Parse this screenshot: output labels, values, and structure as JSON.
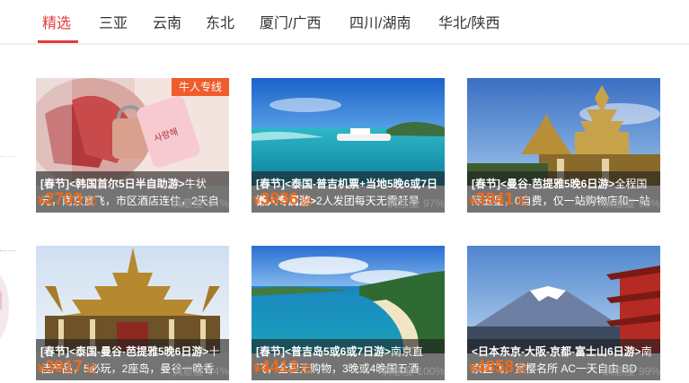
{
  "tabs": [
    {
      "label": "精选",
      "active": true
    },
    {
      "label": "三亚"
    },
    {
      "label": "云南"
    },
    {
      "label": "东北"
    },
    {
      "label": "厦门/广西"
    },
    {
      "label": "四川/湖南"
    },
    {
      "label": "华北/陕西"
    }
  ],
  "products": [
    {
      "badge": "牛人专线",
      "title": "[春节]<韩国首尔5日半自助游>",
      "desc": "牛状元，南京直飞，市区酒店连住，2天自",
      "currency": "¥",
      "price": "2703",
      "price_suffix": "起",
      "satisfaction_label": "满意度",
      "satisfaction": "94%",
      "image_icon": "love-locks-photo"
    },
    {
      "title": "[春节]<泰国-普吉机票+当地5晚6或7日懒人专属游>",
      "desc": "2人发团每天无需赶早",
      "currency": "¥",
      "price": "3836",
      "price_suffix": "起",
      "satisfaction_label": "满意度",
      "satisfaction": "97%",
      "image_icon": "tropical-sea-boat-photo"
    },
    {
      "title": "[春节]<曼谷-芭提雅5晚6日游>",
      "desc": "全程国际五星，0自费，仅一站购物店和一站",
      "currency": "¥",
      "price": "3941",
      "price_suffix": "起",
      "satisfaction_label": "满意度",
      "satisfaction": "98%",
      "image_icon": "thai-temple-photo"
    },
    {
      "title": "[春节]<泰国-曼谷-芭提雅5晚6日游>",
      "desc": "十佳产品，5必玩，2座岛，曼谷一晚香",
      "currency": "¥",
      "price": "3917",
      "price_suffix": "起",
      "satisfaction_label": "满意度",
      "satisfaction": "94%",
      "image_icon": "golden-palace-photo"
    },
    {
      "title": "[春节]<普吉岛5或6或7日游>",
      "desc": "南京直飞，全程无购物，3晚或4晚国五酒",
      "currency": "¥",
      "price": "4413",
      "price_suffix": "起",
      "satisfaction_label": "满意度",
      "satisfaction": "100%",
      "image_icon": "bay-beach-photo"
    },
    {
      "title": "<日本东京-大阪-京都-富士山6日游>",
      "desc": "南京直飞，赏樱名所 AC一天自由 BD",
      "currency": "¥",
      "price": "4858",
      "price_suffix": "起",
      "satisfaction_label": "满意度",
      "satisfaction": "99%",
      "image_icon": "mount-fuji-pagoda-photo"
    }
  ],
  "colors": {
    "accent": "#e4393c",
    "price": "#f46a17",
    "badge": "#f05c2c"
  }
}
